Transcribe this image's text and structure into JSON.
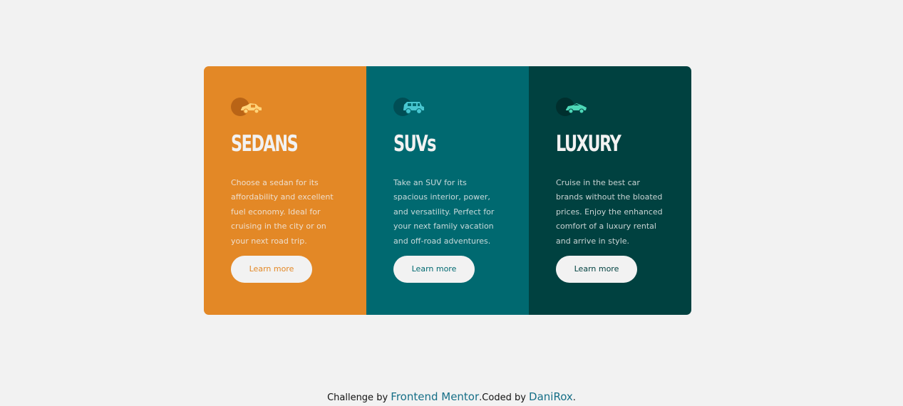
{
  "cards": [
    {
      "id": "sedans",
      "title": "SEDANS",
      "text": "Choose a sedan for its affordability and excellent fuel economy. Ideal for cruising in the city or on your next road trip.",
      "button": "Learn more",
      "icon": "sedan-car-icon",
      "color": "#e38826"
    },
    {
      "id": "suvs",
      "title": "SUVs",
      "text": "Take an SUV for its spacious interior, power, and versatility. Perfect for your next family vacation and off-road adventures.",
      "button": "Learn more",
      "icon": "suv-car-icon",
      "color": "#006970"
    },
    {
      "id": "luxury",
      "title": "LUXURY",
      "text": "Cruise in the best car brands without the bloated prices. Enjoy the enhanced comfort of a luxury rental and arrive in style.",
      "button": "Learn more",
      "icon": "luxury-car-icon",
      "color": "#004140"
    }
  ],
  "footer": {
    "prefix": "Challenge by ",
    "challenge_link": "Frontend Mentor",
    "middle": ".Coded by ",
    "author_link": "DaniRox",
    "suffix": "."
  }
}
